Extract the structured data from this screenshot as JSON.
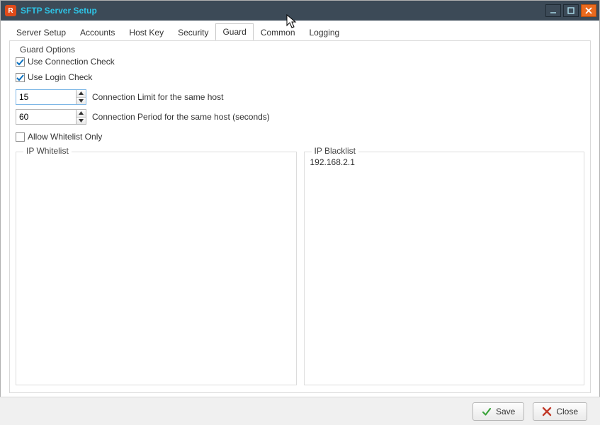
{
  "window": {
    "title": "SFTP Server Setup",
    "icon_letter": "R"
  },
  "tabs": [
    {
      "label": "Server Setup"
    },
    {
      "label": "Accounts"
    },
    {
      "label": "Host Key"
    },
    {
      "label": "Security"
    },
    {
      "label": "Guard"
    },
    {
      "label": "Common"
    },
    {
      "label": "Logging"
    }
  ],
  "active_tab_index": 4,
  "guard": {
    "group_title": "Guard Options",
    "use_connection_check": {
      "label": "Use Connection Check",
      "checked": true
    },
    "use_login_check": {
      "label": "Use Login Check",
      "checked": true
    },
    "conn_limit": {
      "value": "15",
      "label": "Connection Limit for the same host"
    },
    "conn_period": {
      "value": "60",
      "label": "Connection Period for the same host (seconds)"
    },
    "allow_whitelist_only": {
      "label": "Allow Whitelist Only",
      "checked": false
    },
    "whitelist": {
      "title": "IP Whitelist",
      "items": []
    },
    "blacklist": {
      "title": "IP Blacklist",
      "items": [
        "192.168.2.1"
      ]
    }
  },
  "footer": {
    "save_label": "Save",
    "close_label": "Close"
  }
}
